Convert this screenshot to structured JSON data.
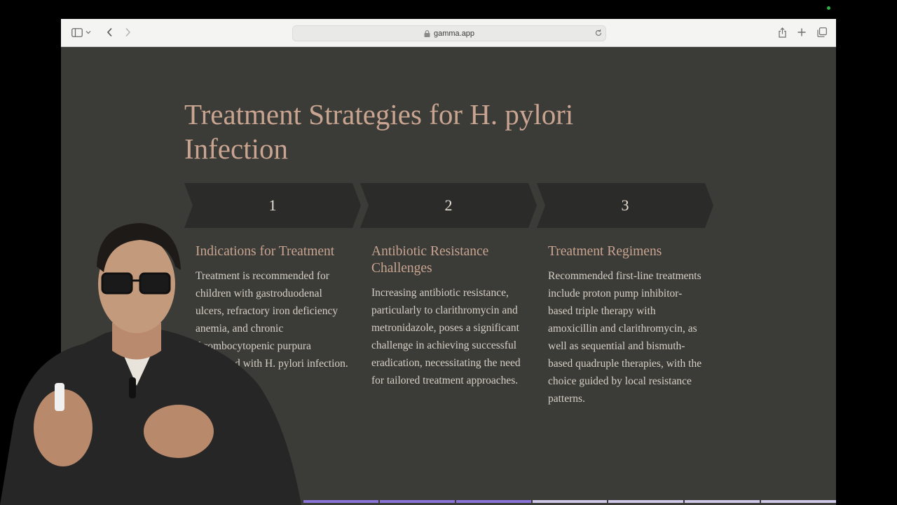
{
  "browser": {
    "url": "gamma.app",
    "icons": [
      "sidebar-icon",
      "chevron-down-icon",
      "back-icon",
      "forward-icon",
      "lock-icon",
      "reload-icon",
      "share-icon",
      "new-tab-icon",
      "tabs-overview-icon"
    ]
  },
  "slide": {
    "title_line1": "Treatment Strategies for H. pylori",
    "title_line2": "Infection",
    "steps": [
      {
        "number": "1",
        "heading": "Indications for Treatment",
        "body": "Treatment is recommended for children with gastroduodenal ulcers, refractory iron deficiency anemia, and chronic thrombocytopenic purpura associated with H. pylori infection."
      },
      {
        "number": "2",
        "heading": "Antibiotic Resistance Challenges",
        "body": "Increasing antibiotic resistance, particularly to clarithromycin and metronidazole, poses a significant challenge in achieving successful eradication, necessitating the need for tailored treatment approaches."
      },
      {
        "number": "3",
        "heading": "Treatment Regimens",
        "body": "Recommended first-line treatments include proton pump inhibitor-based triple therapy with amoxicillin and clarithromycin, as well as sequential and bismuth-based quadruple therapies, with the choice guided by local resistance patterns."
      }
    ]
  },
  "progress": {
    "total_segments": 7,
    "current_segment": 3
  },
  "colors": {
    "slide_bg": "#3b3b37",
    "chevron": "#2b2b29",
    "title": "#c9a591",
    "body_text": "#d6d0c6",
    "progress_active": "#8b74d8",
    "progress_inactive": "#cfc8e6"
  }
}
